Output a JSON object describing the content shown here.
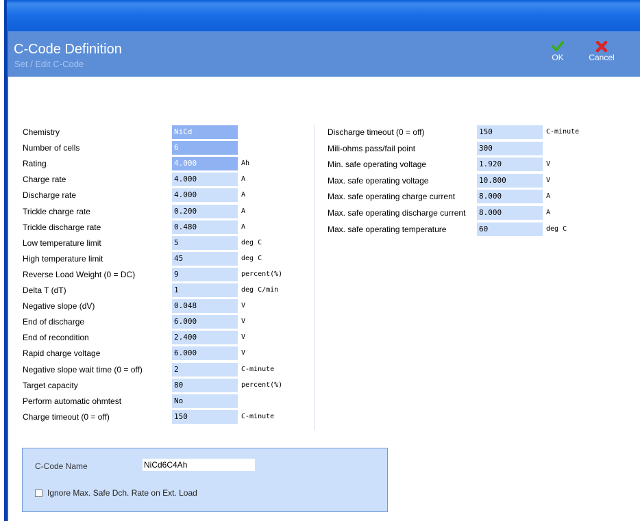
{
  "header": {
    "title": "C-Code Definition",
    "subtitle": "Set / Edit C-Code",
    "ok_label": "OK",
    "cancel_label": "Cancel"
  },
  "left_fields": [
    {
      "label": "Chemistry",
      "value": "NiCd",
      "unit": ""
    },
    {
      "label": "Number of cells",
      "value": "6",
      "unit": ""
    },
    {
      "label": "Rating",
      "value": "4.000",
      "unit": "Ah"
    },
    {
      "label": "Charge rate",
      "value": "4.000",
      "unit": "A"
    },
    {
      "label": "Discharge rate",
      "value": "4.000",
      "unit": "A"
    },
    {
      "label": "Trickle charge rate",
      "value": "0.200",
      "unit": "A"
    },
    {
      "label": "Trickle discharge rate",
      "value": "0.480",
      "unit": "A"
    },
    {
      "label": "Low temperature limit",
      "value": "5",
      "unit": "deg C"
    },
    {
      "label": "High temperature limit",
      "value": "45",
      "unit": "deg C"
    },
    {
      "label": "Reverse Load Weight (0 = DC)",
      "value": "9",
      "unit": "percent(%)"
    },
    {
      "label": "Delta T (dT)",
      "value": "1",
      "unit": "deg C/min"
    },
    {
      "label": "Negative slope (dV)",
      "value": "0.048",
      "unit": "V"
    },
    {
      "label": "End of discharge",
      "value": "6.000",
      "unit": "V"
    },
    {
      "label": "End of recondition",
      "value": "2.400",
      "unit": "V"
    },
    {
      "label": "Rapid charge voltage",
      "value": "6.000",
      "unit": "V"
    },
    {
      "label": "Negative slope wait time (0 = off)",
      "value": "2",
      "unit": "C-minute"
    },
    {
      "label": "Target capacity",
      "value": "80",
      "unit": "percent(%)"
    },
    {
      "label": "Perform automatic ohmtest",
      "value": "No",
      "unit": ""
    },
    {
      "label": "Charge timeout (0 = off)",
      "value": "150",
      "unit": "C-minute"
    }
  ],
  "right_fields": [
    {
      "label": "Discharge timeout (0 = off)",
      "value": "150",
      "unit": "C-minute"
    },
    {
      "label": "Mili-ohms pass/fail point",
      "value": "300",
      "unit": ""
    },
    {
      "label": "Min. safe operating voltage",
      "value": "1.920",
      "unit": "V"
    },
    {
      "label": "Max. safe operating voltage",
      "value": "10.800",
      "unit": "V"
    },
    {
      "label": "Max. safe operating charge current",
      "value": "8.000",
      "unit": "A"
    },
    {
      "label": "Max. safe operating discharge current",
      "value": "8.000",
      "unit": "A"
    },
    {
      "label": "Max. safe operating temperature",
      "value": "60",
      "unit": "deg C"
    }
  ],
  "panel": {
    "name_label": "C-Code Name",
    "name_value": "NiCd6C4Ah",
    "checkbox_label": "Ignore Max. Safe Dch. Rate on Ext. Load",
    "checkbox_checked": false
  },
  "colors": {
    "title_bar": "#1b6fe6",
    "header": "#5c8ed8",
    "field_bg": "#cde0fb",
    "field_highlight": "#8fb2f2",
    "ok_icon": "#3cab1e",
    "cancel_icon": "#d8262a"
  }
}
